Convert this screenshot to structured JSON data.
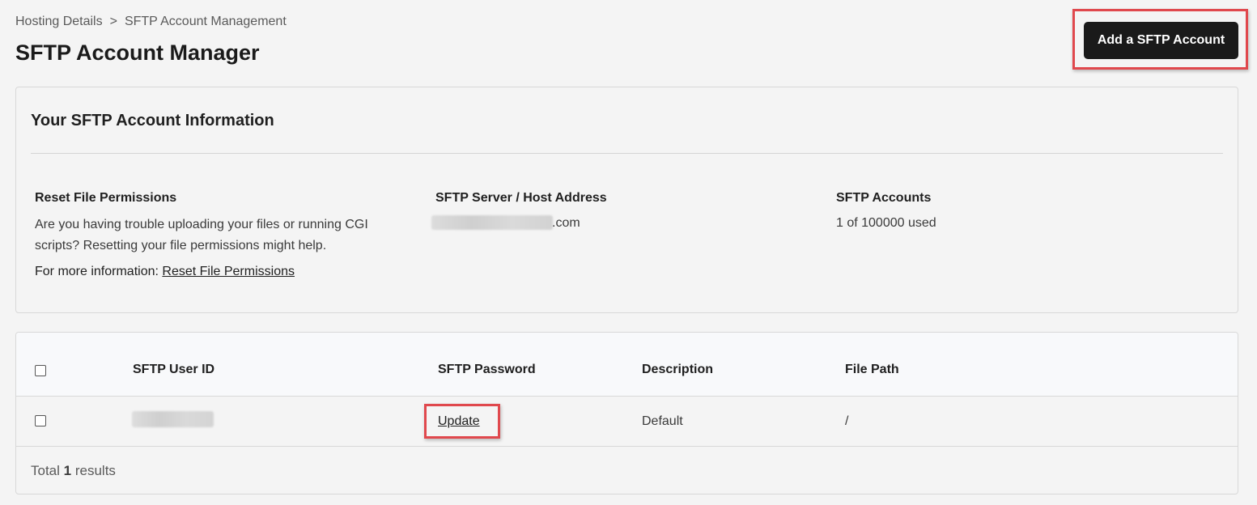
{
  "breadcrumb": {
    "items": [
      "Hosting Details",
      "SFTP Account Management"
    ],
    "separator": ">"
  },
  "page": {
    "title": "SFTP Account Manager",
    "add_button_label": "Add a SFTP Account"
  },
  "info_card": {
    "title": "Your SFTP Account Information",
    "reset": {
      "heading": "Reset File Permissions",
      "line1": "Are you having trouble uploading your files or running CGI",
      "line2": "scripts? Resetting your file permissions might help.",
      "more_prefix": "For more information:",
      "link_label": "Reset File Permissions"
    },
    "server": {
      "heading": "SFTP Server / Host Address",
      "address_suffix": ".com"
    },
    "accounts": {
      "heading": "SFTP Accounts",
      "usage": "1 of 100000 used"
    }
  },
  "table": {
    "columns": [
      "SFTP User ID",
      "SFTP Password",
      "Description",
      "File Path"
    ],
    "rows": [
      {
        "user_id": "",
        "password_action": "Update",
        "description": "Default",
        "file_path": "/"
      }
    ],
    "footer": {
      "prefix": "Total",
      "count": "1",
      "suffix": "results"
    }
  },
  "colors": {
    "highlight": "#e0484d",
    "button_bg": "#1a1a1a",
    "page_bg": "#f4f4f4"
  }
}
